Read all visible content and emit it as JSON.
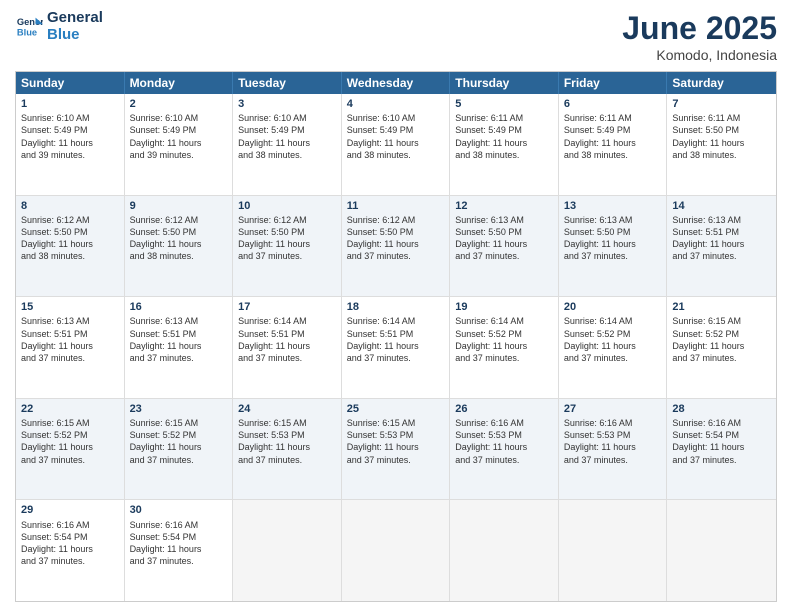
{
  "logo": {
    "line1": "General",
    "line2": "Blue"
  },
  "title": "June 2025",
  "location": "Komodo, Indonesia",
  "header_days": [
    "Sunday",
    "Monday",
    "Tuesday",
    "Wednesday",
    "Thursday",
    "Friday",
    "Saturday"
  ],
  "weeks": [
    {
      "alt": false,
      "cells": [
        {
          "day": "1",
          "info": "Sunrise: 6:10 AM\nSunset: 5:49 PM\nDaylight: 11 hours\nand 39 minutes."
        },
        {
          "day": "2",
          "info": "Sunrise: 6:10 AM\nSunset: 5:49 PM\nDaylight: 11 hours\nand 39 minutes."
        },
        {
          "day": "3",
          "info": "Sunrise: 6:10 AM\nSunset: 5:49 PM\nDaylight: 11 hours\nand 38 minutes."
        },
        {
          "day": "4",
          "info": "Sunrise: 6:10 AM\nSunset: 5:49 PM\nDaylight: 11 hours\nand 38 minutes."
        },
        {
          "day": "5",
          "info": "Sunrise: 6:11 AM\nSunset: 5:49 PM\nDaylight: 11 hours\nand 38 minutes."
        },
        {
          "day": "6",
          "info": "Sunrise: 6:11 AM\nSunset: 5:49 PM\nDaylight: 11 hours\nand 38 minutes."
        },
        {
          "day": "7",
          "info": "Sunrise: 6:11 AM\nSunset: 5:50 PM\nDaylight: 11 hours\nand 38 minutes."
        }
      ]
    },
    {
      "alt": true,
      "cells": [
        {
          "day": "8",
          "info": "Sunrise: 6:12 AM\nSunset: 5:50 PM\nDaylight: 11 hours\nand 38 minutes."
        },
        {
          "day": "9",
          "info": "Sunrise: 6:12 AM\nSunset: 5:50 PM\nDaylight: 11 hours\nand 38 minutes."
        },
        {
          "day": "10",
          "info": "Sunrise: 6:12 AM\nSunset: 5:50 PM\nDaylight: 11 hours\nand 37 minutes."
        },
        {
          "day": "11",
          "info": "Sunrise: 6:12 AM\nSunset: 5:50 PM\nDaylight: 11 hours\nand 37 minutes."
        },
        {
          "day": "12",
          "info": "Sunrise: 6:13 AM\nSunset: 5:50 PM\nDaylight: 11 hours\nand 37 minutes."
        },
        {
          "day": "13",
          "info": "Sunrise: 6:13 AM\nSunset: 5:50 PM\nDaylight: 11 hours\nand 37 minutes."
        },
        {
          "day": "14",
          "info": "Sunrise: 6:13 AM\nSunset: 5:51 PM\nDaylight: 11 hours\nand 37 minutes."
        }
      ]
    },
    {
      "alt": false,
      "cells": [
        {
          "day": "15",
          "info": "Sunrise: 6:13 AM\nSunset: 5:51 PM\nDaylight: 11 hours\nand 37 minutes."
        },
        {
          "day": "16",
          "info": "Sunrise: 6:13 AM\nSunset: 5:51 PM\nDaylight: 11 hours\nand 37 minutes."
        },
        {
          "day": "17",
          "info": "Sunrise: 6:14 AM\nSunset: 5:51 PM\nDaylight: 11 hours\nand 37 minutes."
        },
        {
          "day": "18",
          "info": "Sunrise: 6:14 AM\nSunset: 5:51 PM\nDaylight: 11 hours\nand 37 minutes."
        },
        {
          "day": "19",
          "info": "Sunrise: 6:14 AM\nSunset: 5:52 PM\nDaylight: 11 hours\nand 37 minutes."
        },
        {
          "day": "20",
          "info": "Sunrise: 6:14 AM\nSunset: 5:52 PM\nDaylight: 11 hours\nand 37 minutes."
        },
        {
          "day": "21",
          "info": "Sunrise: 6:15 AM\nSunset: 5:52 PM\nDaylight: 11 hours\nand 37 minutes."
        }
      ]
    },
    {
      "alt": true,
      "cells": [
        {
          "day": "22",
          "info": "Sunrise: 6:15 AM\nSunset: 5:52 PM\nDaylight: 11 hours\nand 37 minutes."
        },
        {
          "day": "23",
          "info": "Sunrise: 6:15 AM\nSunset: 5:52 PM\nDaylight: 11 hours\nand 37 minutes."
        },
        {
          "day": "24",
          "info": "Sunrise: 6:15 AM\nSunset: 5:53 PM\nDaylight: 11 hours\nand 37 minutes."
        },
        {
          "day": "25",
          "info": "Sunrise: 6:15 AM\nSunset: 5:53 PM\nDaylight: 11 hours\nand 37 minutes."
        },
        {
          "day": "26",
          "info": "Sunrise: 6:16 AM\nSunset: 5:53 PM\nDaylight: 11 hours\nand 37 minutes."
        },
        {
          "day": "27",
          "info": "Sunrise: 6:16 AM\nSunset: 5:53 PM\nDaylight: 11 hours\nand 37 minutes."
        },
        {
          "day": "28",
          "info": "Sunrise: 6:16 AM\nSunset: 5:54 PM\nDaylight: 11 hours\nand 37 minutes."
        }
      ]
    },
    {
      "alt": false,
      "cells": [
        {
          "day": "29",
          "info": "Sunrise: 6:16 AM\nSunset: 5:54 PM\nDaylight: 11 hours\nand 37 minutes."
        },
        {
          "day": "30",
          "info": "Sunrise: 6:16 AM\nSunset: 5:54 PM\nDaylight: 11 hours\nand 37 minutes."
        },
        {
          "day": "",
          "info": ""
        },
        {
          "day": "",
          "info": ""
        },
        {
          "day": "",
          "info": ""
        },
        {
          "day": "",
          "info": ""
        },
        {
          "day": "",
          "info": ""
        }
      ]
    }
  ]
}
